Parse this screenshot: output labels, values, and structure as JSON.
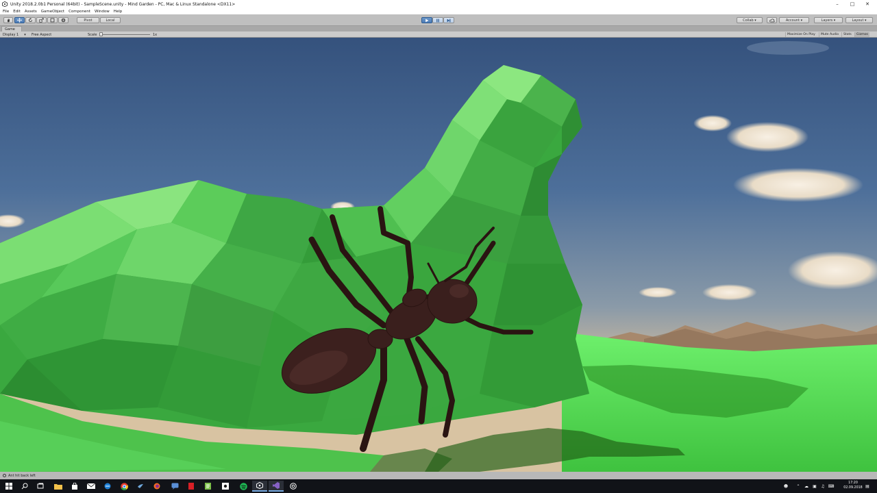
{
  "window": {
    "title": "Unity 2018.2.0b1 Personal (64bit) - SampleScene.unity - Mind Garden - PC, Mac & Linux Standalone <DX11>",
    "minimize": "–",
    "maximize": "□",
    "close": "✕"
  },
  "menu": [
    "File",
    "Edit",
    "Assets",
    "GameObject",
    "Component",
    "Window",
    "Help"
  ],
  "toolbar": {
    "pivot_label": "Pivot",
    "local_label": "Local",
    "collab_label": "Collab ▾",
    "account_label": "Account ▾",
    "layers_label": "Layers ▾",
    "layout_label": "Layout ▾"
  },
  "game_view": {
    "tab_label": "Game",
    "display_label": "Display 1",
    "aspect_label": "Free Aspect",
    "scale_label": "Scale",
    "scale_value": "1x",
    "toggles": [
      "Maximize On Play",
      "Mute Audio",
      "Stats",
      "Gizmos"
    ]
  },
  "status_bar": {
    "message": "Ant hit back left"
  },
  "taskbar": {
    "time": "17:20",
    "date": "02.09.2018"
  },
  "colors": {
    "accent_play": "#4d7db8",
    "sky_top": "#3b5a86",
    "sky_horizon": "#c7b7a0",
    "ground": "#49c94a",
    "rock": "#3fae45",
    "ant": "#3a1f1d"
  }
}
